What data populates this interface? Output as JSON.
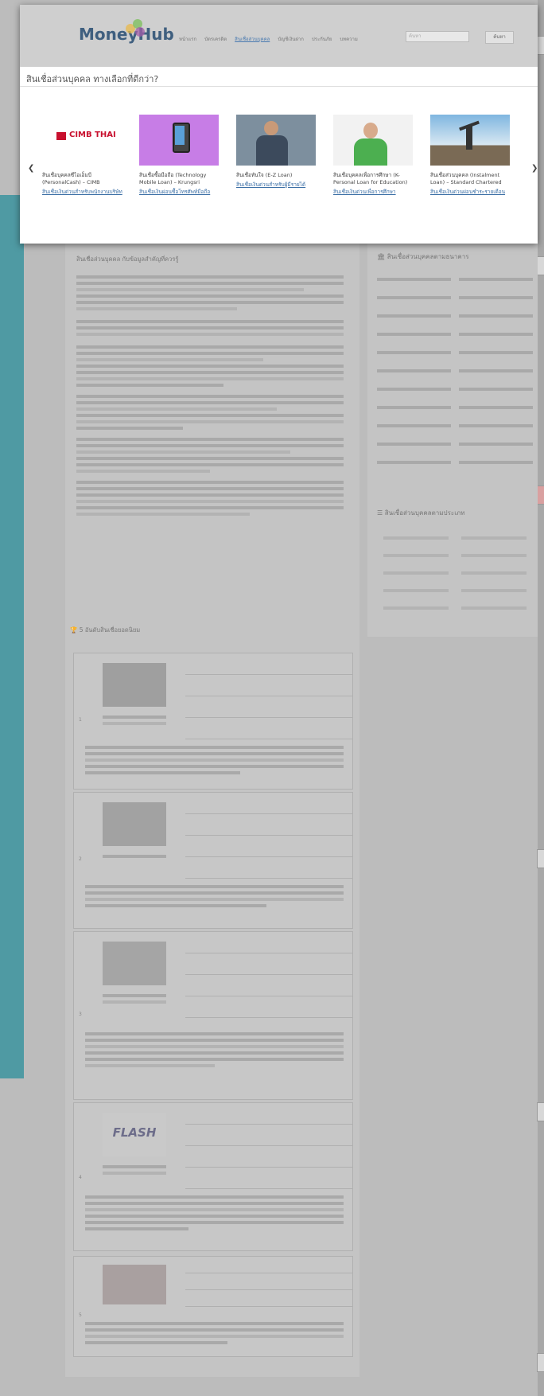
{
  "header": {
    "brand": "MoneyHub",
    "nav": [
      "หน้าแรก",
      "บัตรเครดิต",
      "สินเชื่อส่วนบุคคล",
      "บัญชีเงินฝาก",
      "ประกันภัย",
      "บทความ"
    ],
    "search_placeholder": "ค้นหา",
    "search_button": "ค้นหา"
  },
  "popup": {
    "title": "สินเชื่อส่วนบุคคล ทางเลือกที่ดีกว่า?",
    "prev_label": "❮",
    "next_label": "❯",
    "cards": [
      {
        "title": "สินเชื่อบุคคลซีไอเอ็มบี (PersonalCash) – CIMB",
        "link": "สินเชื่อเงินด่วนสำหรับพนักงานบริษัท",
        "logo": "CIMB THAI"
      },
      {
        "title": "สินเชื่อซื้อมือถือ (Technology Mobile Loan) – Krungsri",
        "link": "สินเชื่อเงินผ่อนซื้อโทรศัพท์มือถือ"
      },
      {
        "title": "สินเชื่อทันใจ (E-Z Loan)",
        "link": "สินเชื่อเงินด่วนสำหรับผู้มีรายได้"
      },
      {
        "title": "สินเชื่อบุคคลเพื่อการศึกษา (K-Personal Loan for Education)",
        "link": "สินเชื่อเงินด่วนเพื่อการศึกษา"
      },
      {
        "title": "สินเชื่อส่วนบุคคล (Instalment Loan) – Standard Chartered",
        "link": "สินเชื่อเงินด่วนผ่อนชำระรายเดือน"
      }
    ]
  },
  "main": {
    "section_heading": "สินเชื่อส่วนบุคคล กับข้อมูลสำคัญที่ควรรู้",
    "top5_heading": "5 อันดับสินเชื่อยอดนิยม",
    "sidebar_bank_heading": "สินเชื่อส่วนบุคคลตามธนาคาร",
    "sidebar_type_heading": "สินเชื่อส่วนบุคคลตามประเภท",
    "top5": [
      {
        "rank": "1",
        "flash": ""
      },
      {
        "rank": "2",
        "flash": ""
      },
      {
        "rank": "3",
        "flash": ""
      },
      {
        "rank": "4",
        "flash": "FLASH"
      },
      {
        "rank": "5",
        "flash": ""
      }
    ]
  }
}
